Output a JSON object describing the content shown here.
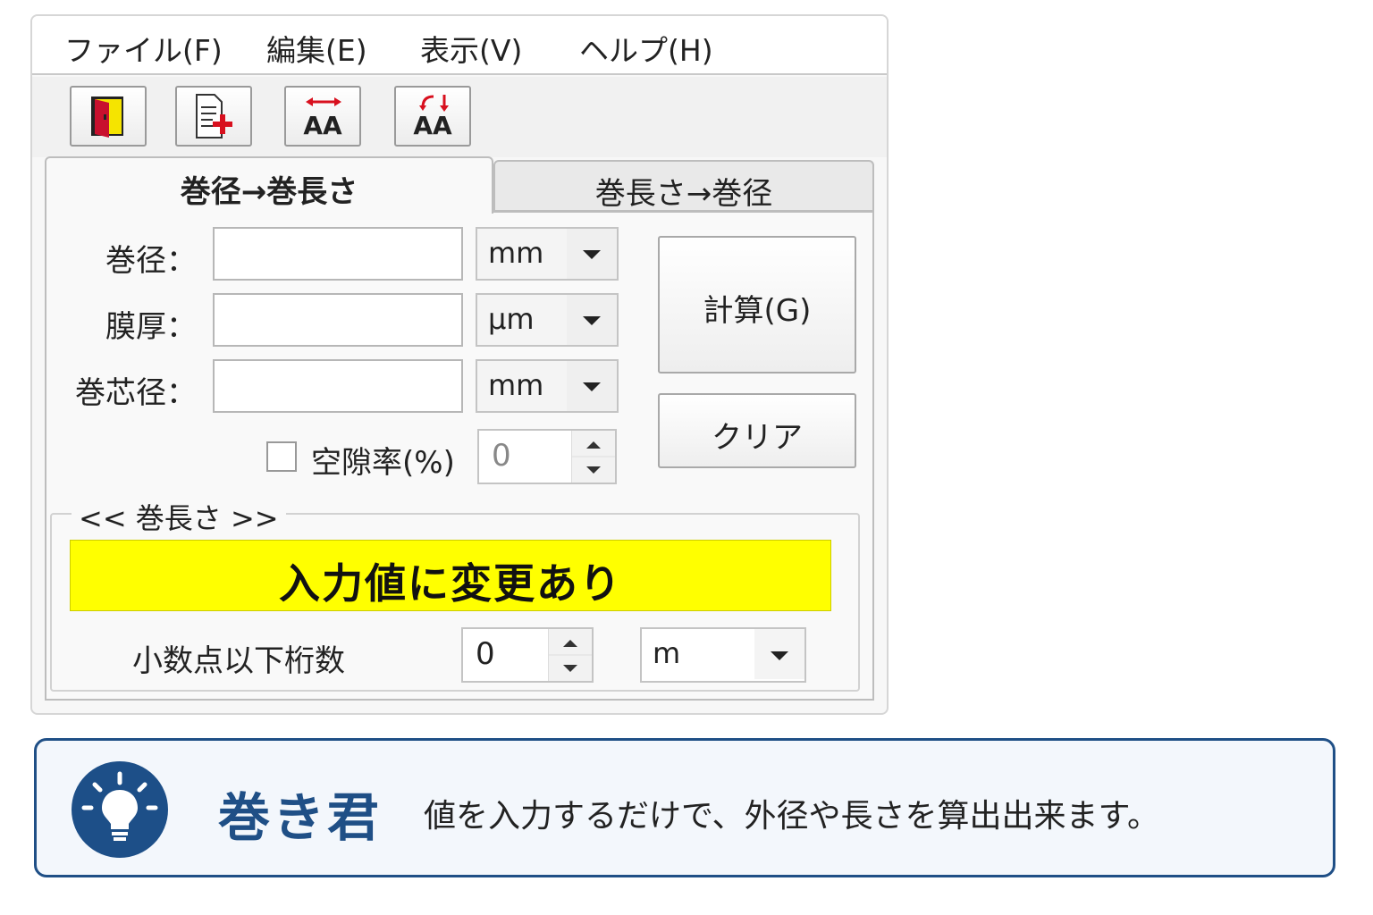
{
  "menu": [
    "ファイル(F)",
    "編集(E)",
    "表示(V)",
    "ヘルプ(H)"
  ],
  "toolbar": {
    "icons": [
      "exit-door-icon",
      "new-document-icon",
      "font-size-toggle-icon",
      "font-swap-icon"
    ],
    "aa_label": "AA"
  },
  "tabs": {
    "active": "巻径→巻長さ",
    "inactive": "巻長さ→巻径"
  },
  "form": {
    "diameter_label": "巻径：",
    "diameter_value": "",
    "diameter_unit": "mm",
    "thickness_label": "膜厚：",
    "thickness_value": "",
    "thickness_unit": "μm",
    "core_label": "巻芯径：",
    "core_value": "",
    "core_unit": "mm",
    "void_label": "空隙率(%)",
    "void_checked": false,
    "void_value": "0"
  },
  "buttons": {
    "calc": "計算(G)",
    "clear": "クリア"
  },
  "result": {
    "group_title": "<< 巻長さ >>",
    "status": "入力値に変更あり",
    "status_color": "#ffff00",
    "decimals_label": "小数点以下桁数",
    "decimals_value": "0",
    "unit": "m"
  },
  "banner": {
    "app_name": "巻き君",
    "description": "値を入力するだけで、外径や長さを算出出来ます。",
    "accent_color": "#1f4f86",
    "icon": "lightbulb-icon"
  }
}
